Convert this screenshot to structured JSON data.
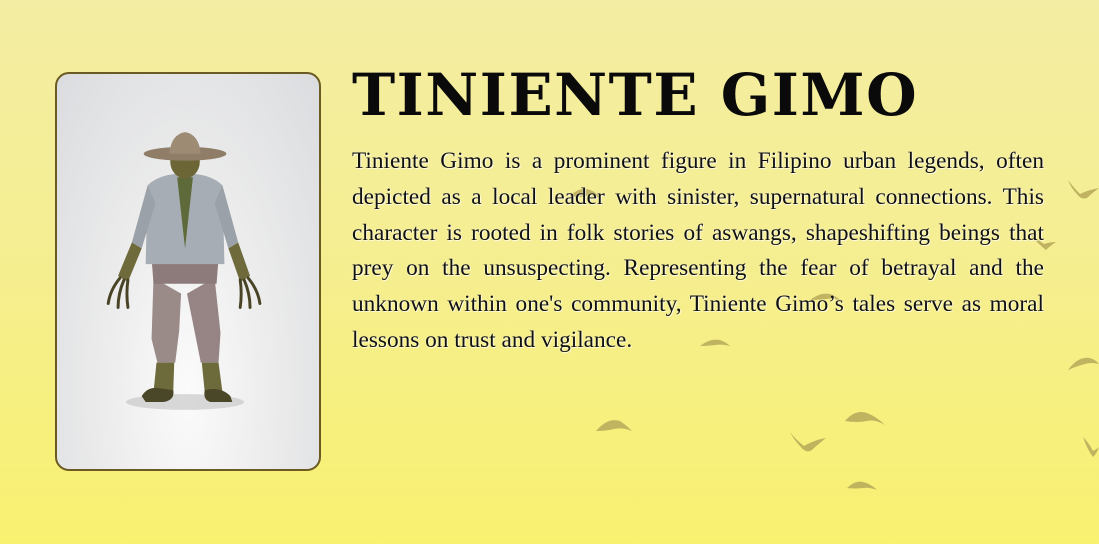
{
  "character": {
    "name": "TINIENTE GIMO",
    "description": "Tiniente Gimo is a prominent figure in Filipino urban legends, often depicted as a local leader with sinister, supernatural connections. This character is rooted in folk stories of aswangs, shapeshifting beings that prey on the unsuspecting. Representing the fear of betrayal and the unknown within one's community, Tiniente Gimo’s tales serve as moral lessons on trust and vigilance."
  },
  "theme": {
    "background_top": "#f3eda3",
    "background_bottom": "#f8f170",
    "card_border": "#6b5a22",
    "bird_color": "#b5a857"
  },
  "icons": {
    "character_figure": "character-model-icon",
    "birds": "bird-icon"
  }
}
